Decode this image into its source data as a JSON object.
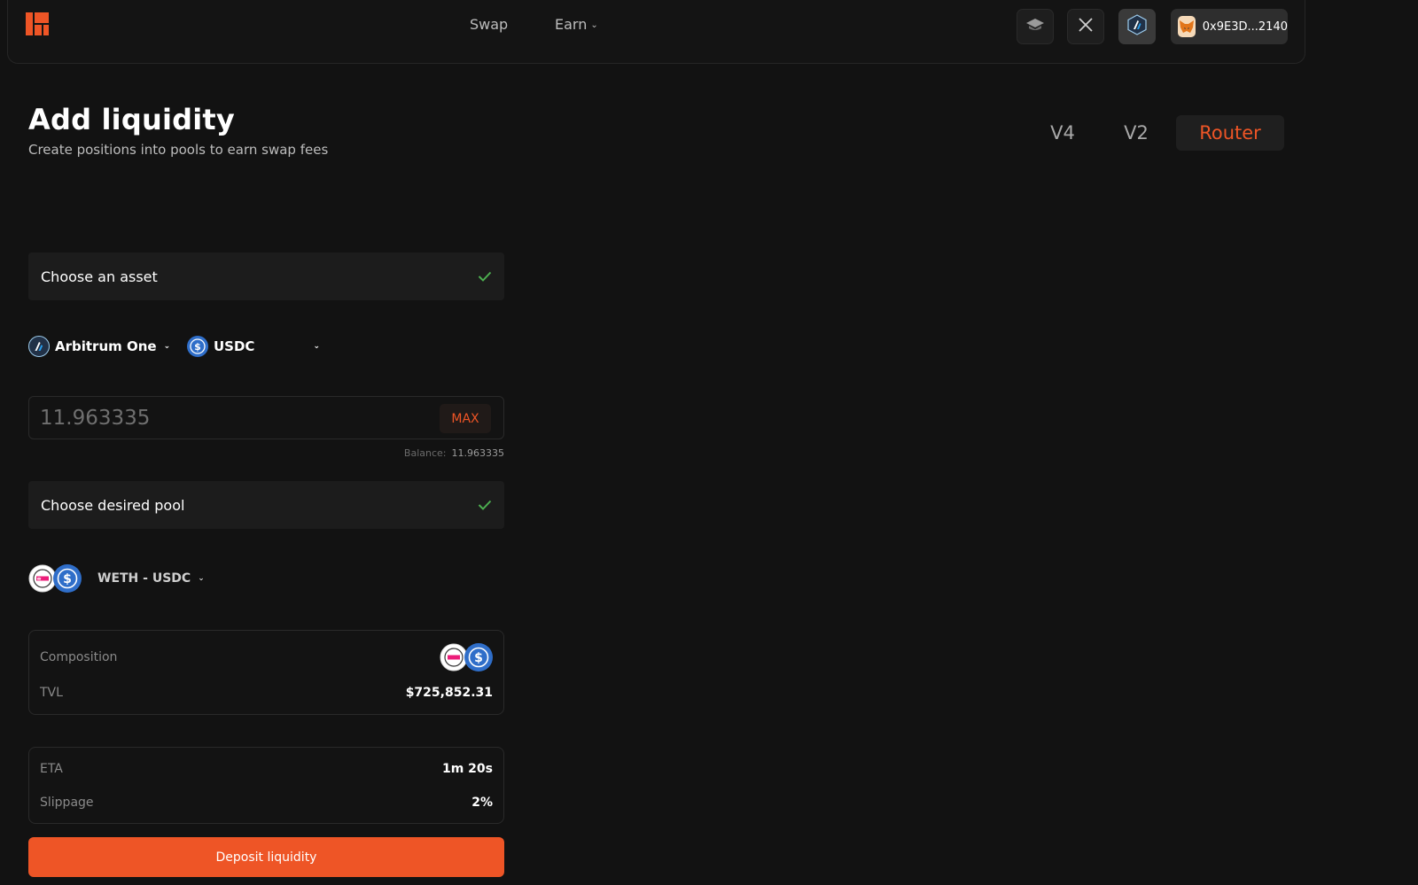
{
  "header": {
    "nav": {
      "swap": "Swap",
      "earn": "Earn"
    },
    "wallet_address": "0x9E3D...2140",
    "icons": [
      "logo-icon",
      "docs-icon",
      "x-icon",
      "arbitrum-icon",
      "metamask-icon"
    ]
  },
  "page": {
    "title": "Add liquidity",
    "subtitle": "Create positions into pools to earn swap fees",
    "version_tabs": [
      "V4",
      "V2",
      "Router"
    ],
    "active_tab": "Router"
  },
  "asset_step": {
    "label": "Choose an asset",
    "network": "Arbitrum One",
    "token": "USDC",
    "amount_placeholder": "11.963335",
    "max_label": "MAX",
    "balance_label": "Balance:",
    "balance_value": "11.963335"
  },
  "pool_step": {
    "label": "Choose desired pool",
    "pool": "WETH - USDC"
  },
  "pool_info": {
    "composition_label": "Composition",
    "tvl_label": "TVL",
    "tvl_value": "$725,852.31"
  },
  "tx_info": {
    "eta_label": "ETA",
    "eta_value": "1m 20s",
    "slippage_label": "Slippage",
    "slippage_value": "2%"
  },
  "actions": {
    "deposit": "Deposit liquidity"
  },
  "colors": {
    "accent": "#ee5526",
    "background": "#121212",
    "check": "#4caf50",
    "usdc": "#2f6ec9"
  }
}
